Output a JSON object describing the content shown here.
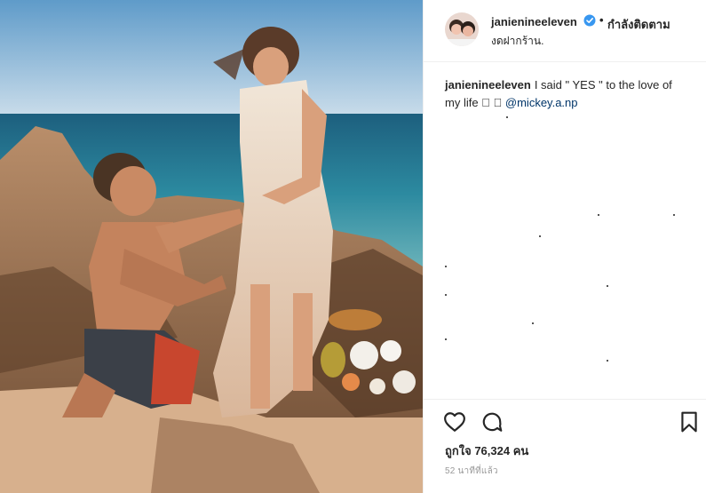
{
  "post": {
    "username": "janienineeleven",
    "follow_status": "กำลังติดตาม",
    "location": "งดฝากร้าน.",
    "caption_username": "janienineeleven",
    "caption_text": "I said \" YES \" to the love of my life 🏻 🏻 ",
    "caption_mention": "@mickey.a.np",
    "likes_text": "ถูกใจ 76,324 คน",
    "time_ago": "52 นาทีที่แล้ว"
  },
  "icons": {
    "verified": "verified-badge-icon",
    "like": "heart-icon",
    "comment": "comment-icon",
    "save": "bookmark-icon",
    "dot_separator": "•"
  },
  "colors": {
    "verified_blue": "#3897f0",
    "text": "#262626",
    "muted": "#999999",
    "mention": "#003569"
  }
}
